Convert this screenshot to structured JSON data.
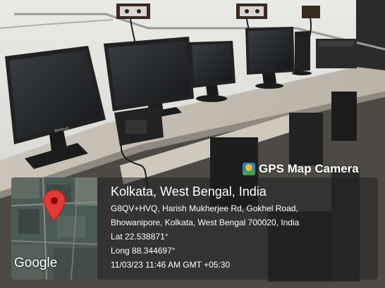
{
  "stamp": {
    "app_badge": "GPS Map Camera",
    "location_title": "Kolkata, West Bengal, India",
    "address_line_1": "G8QV+HVQ, Harish Mukherjee Rd, Gokhel Road,",
    "address_line_2": "Bhowanipore, Kolkata, West Bengal 700020, India",
    "latitude": "Lat 22.538871°",
    "longitude": "Long 88.344697°",
    "timestamp": "11/03/23 11:46 AM GMT +05:30",
    "map_attribution": "Google",
    "pin_color": "#e53935"
  },
  "scene": {
    "description_icons": [
      "monitor-icon",
      "desk-phone-icon",
      "cpu-tower-icon"
    ],
    "monitor_brand": "lenovo"
  }
}
